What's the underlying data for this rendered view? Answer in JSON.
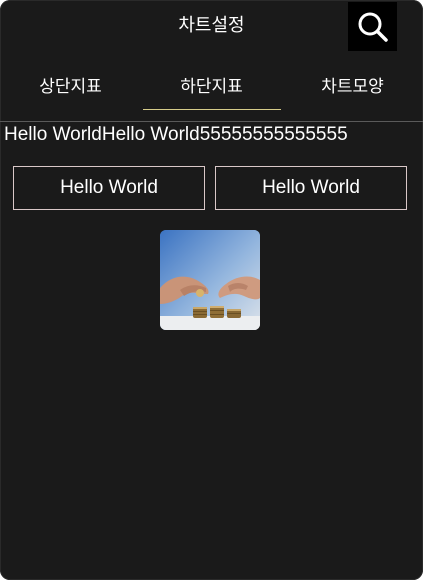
{
  "header": {
    "title": "차트설정",
    "search_icon": "search-icon"
  },
  "tabs": [
    {
      "label": "상단지표",
      "active": false
    },
    {
      "label": "하단지표",
      "active": true
    },
    {
      "label": "차트모양",
      "active": false
    }
  ],
  "content": {
    "info_text": "Hello WorldHello World55555555555555",
    "buttons": [
      {
        "label": "Hello World"
      },
      {
        "label": "Hello World"
      }
    ],
    "thumbnail_icon": "coins-photo"
  },
  "colors": {
    "background": "#1a1a1a",
    "text": "#ffffff",
    "tab_underline": "#d6cc8a",
    "button_border": "#d9c8c8",
    "search_bg": "#000000"
  }
}
